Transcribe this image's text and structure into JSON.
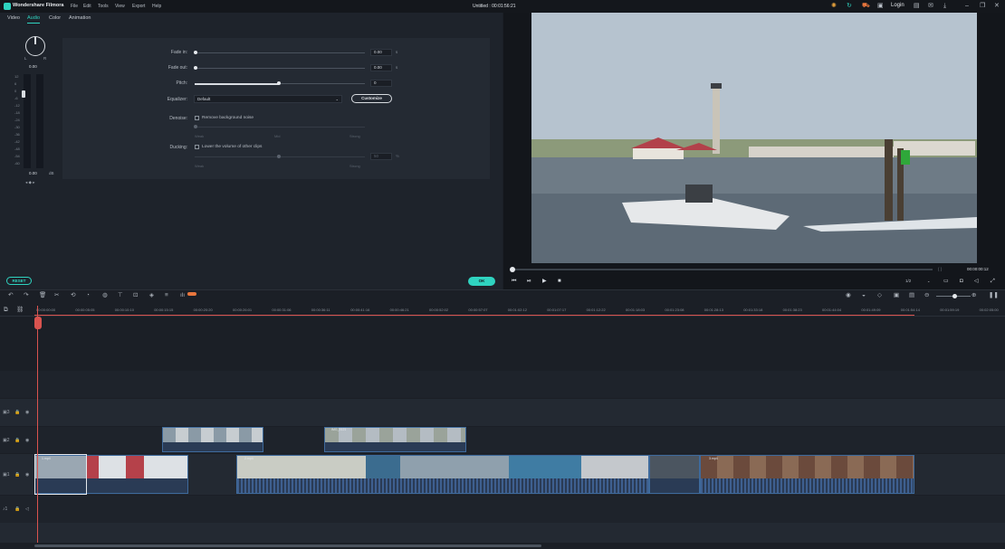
{
  "window": {
    "app_name": "Wondershare Filmora",
    "menu": [
      "File",
      "Edit",
      "Tools",
      "View",
      "Export",
      "Help"
    ],
    "doc_title": "Untitled : 00:01:56:21",
    "login_label": "Login"
  },
  "tabs": [
    {
      "label": "Video",
      "active": false
    },
    {
      "label": "Audio",
      "active": true
    },
    {
      "label": "Color",
      "active": false
    },
    {
      "label": "Animation",
      "active": false
    }
  ],
  "meter": {
    "balance_L": "L",
    "balance_R": "R",
    "balance_value": "0.00",
    "scale": [
      "12",
      "6",
      "0",
      "-6",
      "-12",
      "-18",
      "-24",
      "-30",
      "-36",
      "-42",
      "-48",
      "-54",
      "-60"
    ],
    "readout": "0.00",
    "unit": "dB"
  },
  "audio": {
    "fade_in": {
      "label": "Fade in:",
      "value": "0.00",
      "unit": "s"
    },
    "fade_out": {
      "label": "Fade out:",
      "value": "0.00",
      "unit": "s"
    },
    "pitch": {
      "label": "Pitch:",
      "value": "0"
    },
    "equalizer": {
      "label": "Equalizer:",
      "value": "Default",
      "customize": "Customize"
    },
    "denoise": {
      "label": "Denoise:",
      "checkbox": "Remove background noise",
      "weak": "Weak",
      "mid": "Mid",
      "strong": "Strong"
    },
    "ducking": {
      "label": "Ducking:",
      "checkbox": "Lower the volume of other clips",
      "value": "50",
      "unit": "%",
      "weak": "Weak",
      "strong": "Strong"
    }
  },
  "buttons": {
    "reset": "RESET",
    "ok": "OK"
  },
  "preview": {
    "time": "00:00:00:12",
    "brackets": "{   }",
    "ratio": "1/2"
  },
  "ruler": [
    "00:00:00:00",
    "00:00:05:05",
    "00:00:10:10",
    "00:00:15:15",
    "00:00:20:20",
    "00:00:26:01",
    "00:00:31:06",
    "00:00:36:11",
    "00:00:41:16",
    "00:00:46:21",
    "00:00:52:02",
    "00:00:57:07",
    "00:01:02:12",
    "00:01:07:17",
    "00:01:12:22",
    "00:01:18:03",
    "00:01:23:08",
    "00:01:28:13",
    "00:01:33:18",
    "00:01:38:23",
    "00:01:44:04",
    "00:01:49:09",
    "00:01:54:14",
    "00:01:59:19",
    "00:02:05:00"
  ],
  "clips": {
    "v1a": "1.mp4",
    "v2a": "IMG_5121",
    "v2b": "2.mp4",
    "v3a": "3.mp4"
  },
  "colors": {
    "accent": "#2fd3c0",
    "playhead": "#d9534f",
    "clip_border": "#3e6a9c"
  }
}
